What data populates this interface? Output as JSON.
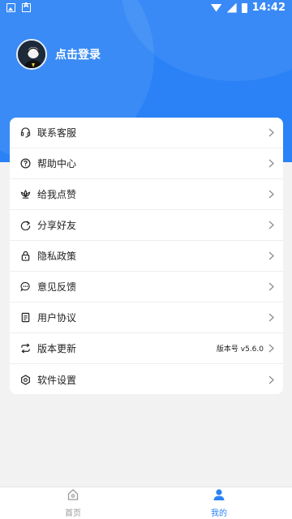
{
  "statusbar": {
    "time": "14:42"
  },
  "profile": {
    "login_text": "点击登录"
  },
  "menu": {
    "items": [
      {
        "label": "联系客服",
        "icon": "headset-icon"
      },
      {
        "label": "帮助中心",
        "icon": "question-icon"
      },
      {
        "label": "给我点赞",
        "icon": "lotus-icon"
      },
      {
        "label": "分享好友",
        "icon": "share-icon"
      },
      {
        "label": "隐私政策",
        "icon": "lock-icon"
      },
      {
        "label": "意见反馈",
        "icon": "chat-icon"
      },
      {
        "label": "用户协议",
        "icon": "document-icon"
      },
      {
        "label": "版本更新",
        "icon": "refresh-icon",
        "extra": "版本号 v5.6.0"
      },
      {
        "label": "软件设置",
        "icon": "settings-icon"
      }
    ]
  },
  "tabs": [
    {
      "label": "首页",
      "icon": "home-icon",
      "active": false
    },
    {
      "label": "我的",
      "icon": "user-icon",
      "active": true
    }
  ],
  "colors": {
    "primary": "#2a82f6",
    "background": "#f2f2f2",
    "inactive": "#9a9a9a"
  }
}
